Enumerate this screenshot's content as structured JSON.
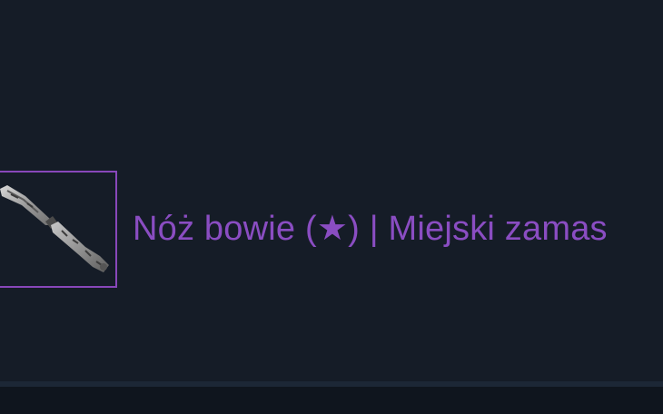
{
  "item": {
    "name": "Nóż bowie (★) | Miejski zamas",
    "rarity_color": "#8847ba",
    "thumbnail_icon": "bowie-knife-urban-masked-icon"
  },
  "theme": {
    "background": "#151c27",
    "footer": "#0f151e"
  }
}
